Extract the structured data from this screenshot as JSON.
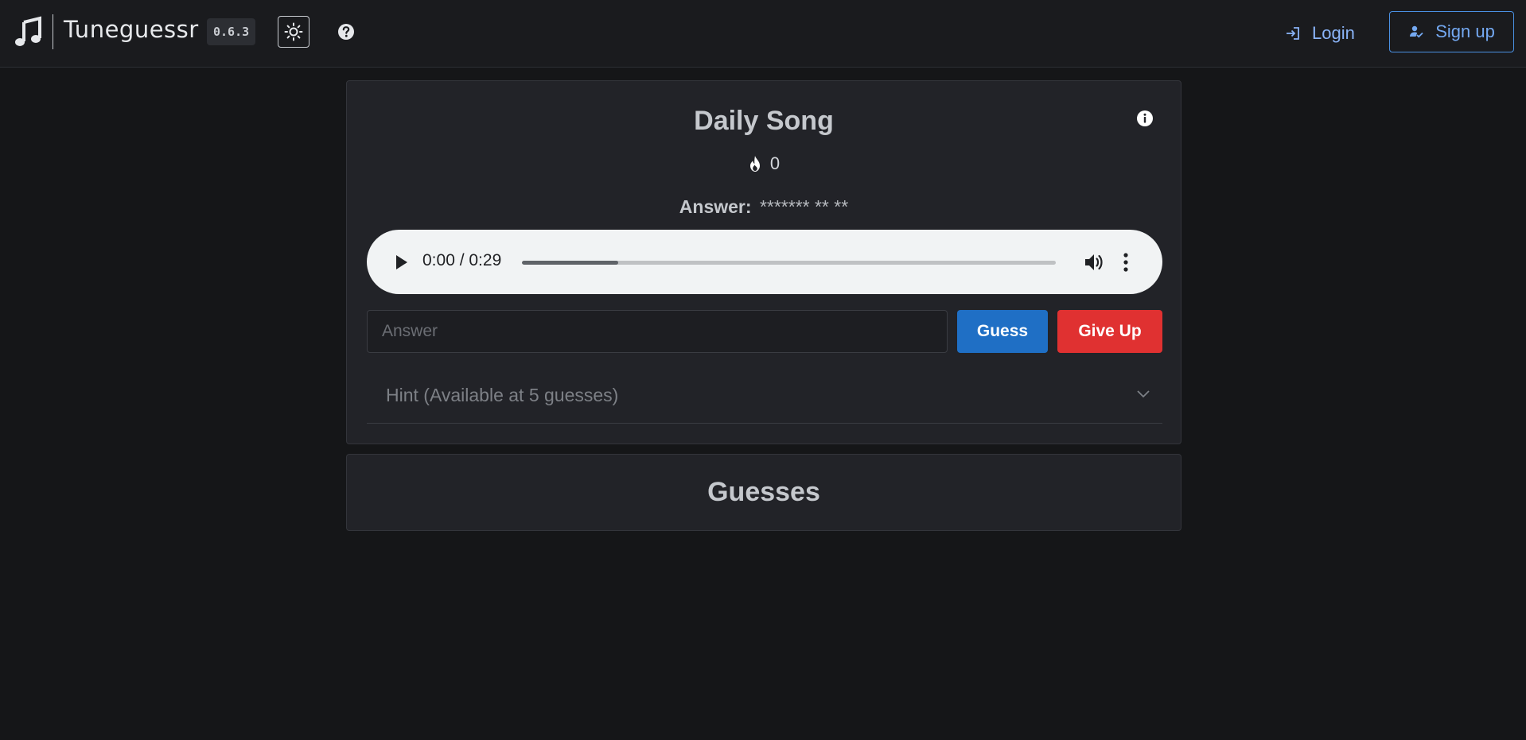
{
  "header": {
    "app_title": "Tuneguessr",
    "version": "0.6.3",
    "login_label": "Login",
    "signup_label": "Sign up"
  },
  "daily": {
    "title": "Daily Song",
    "streak_count": "0",
    "answer_label": "Answer:",
    "answer_mask": "******* ** **"
  },
  "player": {
    "time": "0:00 / 0:29",
    "progress_fraction": 0.18
  },
  "guess_form": {
    "placeholder": "Answer",
    "value": "",
    "guess_label": "Guess",
    "give_up_label": "Give Up"
  },
  "hint": {
    "label": "Hint (Available at 5 guesses)"
  },
  "guesses": {
    "title": "Guesses"
  },
  "colors": {
    "background": "#151618",
    "card": "#222328",
    "guess_button": "#1f6fc5",
    "give_up_button": "#e03131",
    "link_accent": "#8ab4f8"
  },
  "icons": {
    "logo": "music-note-icon",
    "theme": "sun-icon",
    "help": "question-circle-icon",
    "login": "login-icon",
    "signup": "user-check-icon",
    "info": "info-circle-icon",
    "streak": "flame-icon",
    "play": "play-icon",
    "volume": "volume-icon",
    "more": "more-vertical-icon",
    "expand": "chevron-down-icon"
  }
}
